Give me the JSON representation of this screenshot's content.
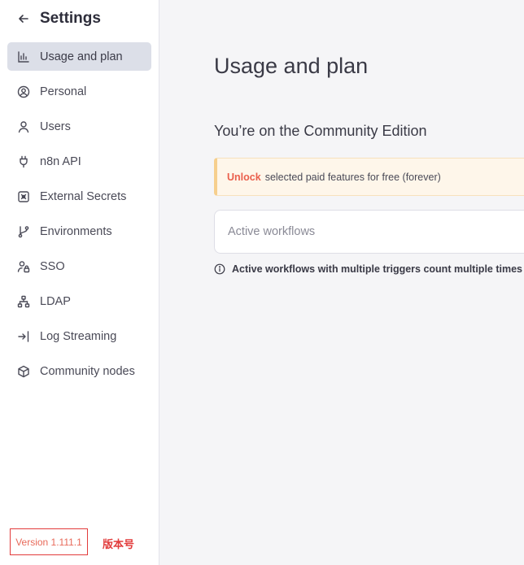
{
  "sidebar": {
    "title": "Settings",
    "back_icon": "arrow-left-icon",
    "items": [
      {
        "label": "Usage and plan",
        "icon": "bar-chart-icon",
        "active": true
      },
      {
        "label": "Personal",
        "icon": "user-circle-icon",
        "active": false
      },
      {
        "label": "Users",
        "icon": "user-icon",
        "active": false
      },
      {
        "label": "n8n API",
        "icon": "plug-icon",
        "active": false
      },
      {
        "label": "External Secrets",
        "icon": "vault-icon",
        "active": false
      },
      {
        "label": "Environments",
        "icon": "git-branch-icon",
        "active": false
      },
      {
        "label": "SSO",
        "icon": "user-lock-icon",
        "active": false
      },
      {
        "label": "LDAP",
        "icon": "network-icon",
        "active": false
      },
      {
        "label": "Log Streaming",
        "icon": "sign-in-icon",
        "active": false
      },
      {
        "label": "Community nodes",
        "icon": "cube-icon",
        "active": false
      }
    ],
    "version": "Version 1.111.1",
    "version_annotation": "版本号"
  },
  "main": {
    "title": "Usage and plan",
    "edition": "You’re on the Community Edition",
    "callout": {
      "link_label": "Unlock",
      "text": "selected paid features for free (forever)"
    },
    "active_workflows_label": "Active workflows",
    "info_text": "Active workflows with multiple triggers count multiple times"
  },
  "colors": {
    "accent": "#ea5f4c",
    "active_nav_bg": "#dcdfe8",
    "callout_bg": "#fef6ea",
    "callout_border": "#f6cf8d",
    "annotation_red": "#e23b3b"
  }
}
